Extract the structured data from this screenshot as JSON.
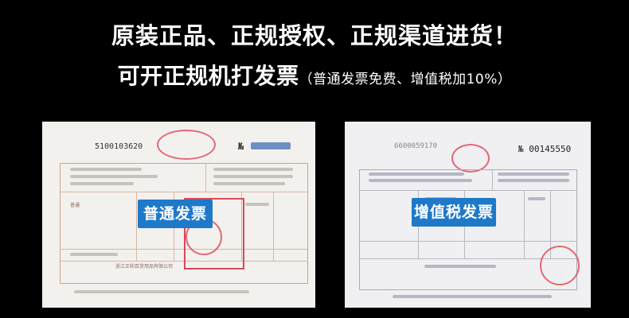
{
  "headline": {
    "line1": "原装正品、正规授权、正规渠道进货！",
    "line2_main": "可开正规机打发票",
    "line2_note": "（普通发票免费、增值税加10%）"
  },
  "invoices": [
    {
      "badge": "普通发票",
      "invoice_code": "5100103620",
      "no_label": "№",
      "item_name": "普通",
      "seller": "浙江正和百货用品有限公司"
    },
    {
      "badge": "增值税发票",
      "invoice_code": "6600059170",
      "no_label": "№",
      "invoice_no": "00145550"
    }
  ],
  "colors": {
    "background": "#000000",
    "badge": "#1f79c9",
    "seal": "#e05060"
  }
}
